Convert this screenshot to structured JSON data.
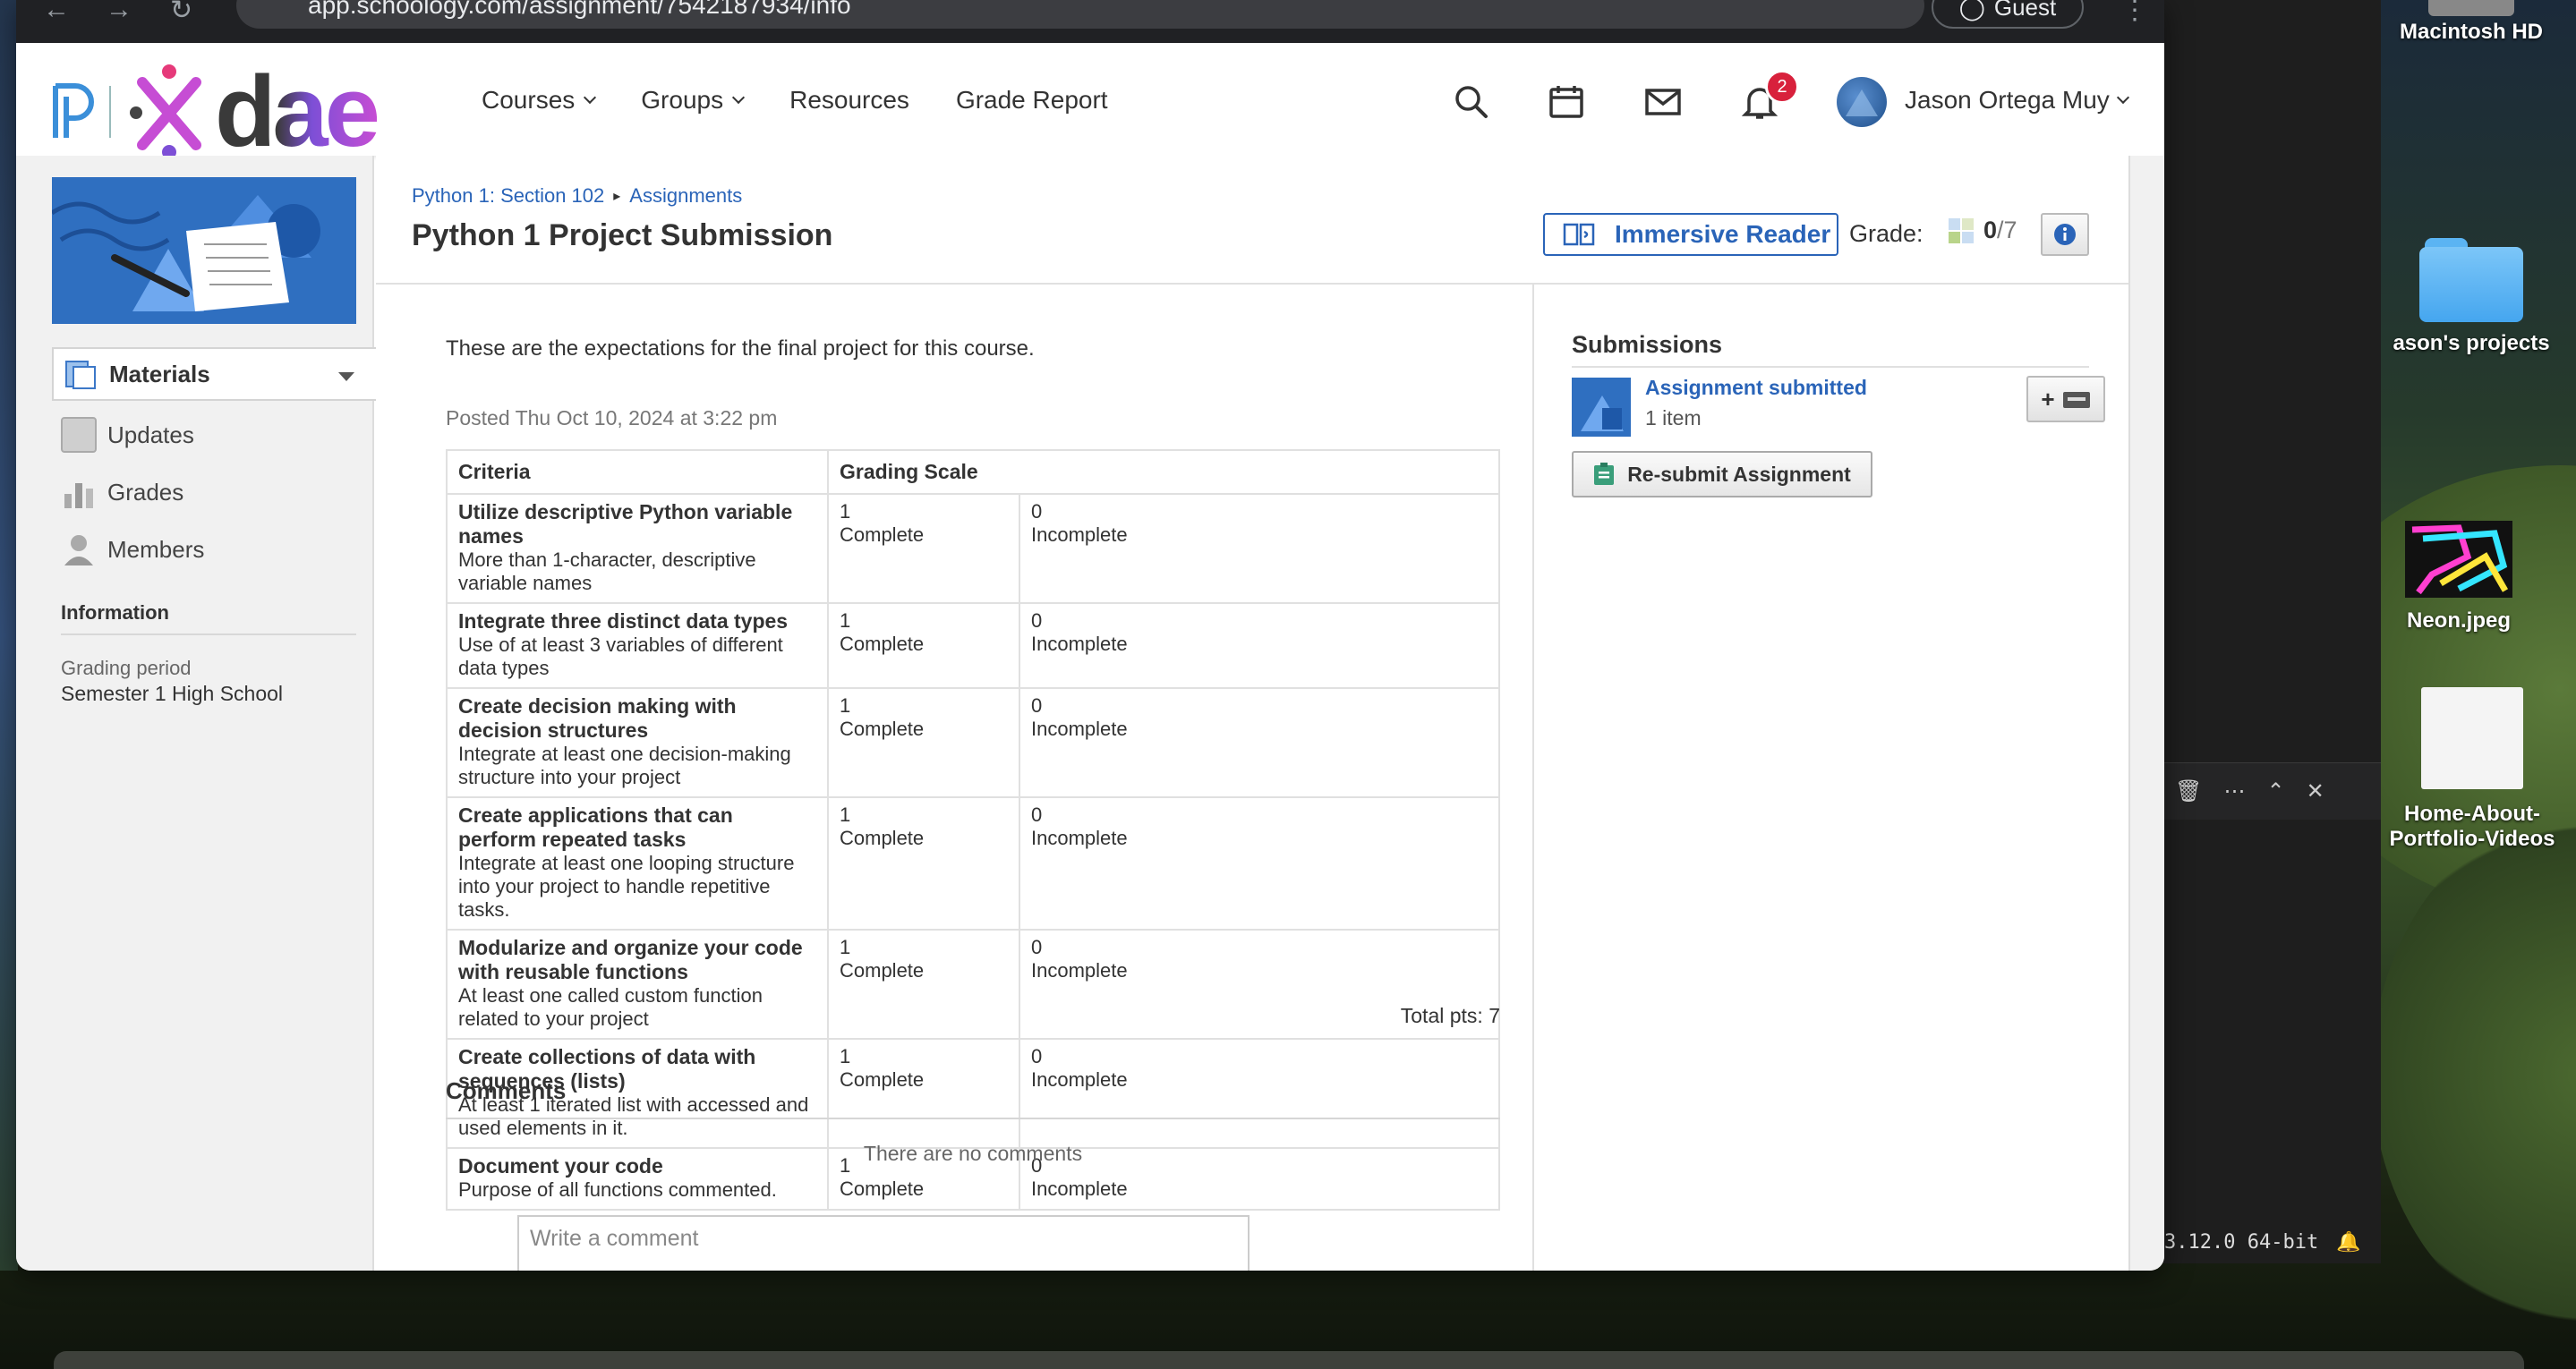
{
  "browser": {
    "url": "app.schoology.com/assignment/7542187934/info",
    "guest_label": "Guest"
  },
  "header": {
    "nav": [
      {
        "label": "Courses",
        "dropdown": true
      },
      {
        "label": "Groups",
        "dropdown": true
      },
      {
        "label": "Resources",
        "dropdown": false
      },
      {
        "label": "Grade Report",
        "dropdown": false
      }
    ],
    "notification_count": "2",
    "user_name": "Jason Ortega Muy"
  },
  "sidebar": {
    "selected": "Materials",
    "items": [
      {
        "label": "Updates",
        "icon": "updates-icon"
      },
      {
        "label": "Grades",
        "icon": "grades-icon"
      },
      {
        "label": "Members",
        "icon": "members-icon"
      }
    ],
    "info_heading": "Information",
    "grading_period_label": "Grading period",
    "grading_period_value": "Semester 1 High School"
  },
  "assignment": {
    "breadcrumb": [
      "Python 1: Section 102",
      "Assignments"
    ],
    "title": "Python 1 Project Submission",
    "immersive_reader_label": "Immersive Reader",
    "grade_label": "Grade:",
    "grade_score": "0",
    "grade_total": "/7",
    "description": "These are the expectations for the final project for this course.",
    "posted": "Posted Thu Oct 10, 2024 at 3:22 pm",
    "rubric": {
      "headers": [
        "Criteria",
        "Grading Scale"
      ],
      "rows": [
        {
          "title": "Utilize descriptive Python variable names",
          "desc": "More than 1-character, descriptive variable names",
          "hi_pts": "1",
          "hi_label": "Complete",
          "lo_pts": "0",
          "lo_label": "Incomplete"
        },
        {
          "title": "Integrate three distinct data types",
          "desc": "Use of at least 3 variables of different data types",
          "hi_pts": "1",
          "hi_label": "Complete",
          "lo_pts": "0",
          "lo_label": "Incomplete"
        },
        {
          "title": "Create decision making with decision structures",
          "desc": "Integrate at least one decision-making structure into your project",
          "hi_pts": "1",
          "hi_label": "Complete",
          "lo_pts": "0",
          "lo_label": "Incomplete"
        },
        {
          "title": "Create applications that can perform repeated tasks",
          "desc": "Integrate at least one looping structure into your project to handle repetitive tasks.",
          "hi_pts": "1",
          "hi_label": "Complete",
          "lo_pts": "0",
          "lo_label": "Incomplete"
        },
        {
          "title": "Modularize and organize your code with reusable functions",
          "desc": "At least one called custom function related to your project",
          "hi_pts": "1",
          "hi_label": "Complete",
          "lo_pts": "0",
          "lo_label": "Incomplete"
        },
        {
          "title": "Create collections of data with sequences (lists)",
          "desc": "At least 1 iterated list with accessed and used elements in it.",
          "hi_pts": "1",
          "hi_label": "Complete",
          "lo_pts": "0",
          "lo_label": "Incomplete"
        },
        {
          "title": "Document your code",
          "desc": "Purpose of all functions commented.",
          "hi_pts": "1",
          "hi_label": "Complete",
          "lo_pts": "0",
          "lo_label": "Incomplete"
        }
      ]
    },
    "total_pts": "Total pts: 7",
    "comments_heading": "Comments",
    "no_comments": "There are no comments",
    "comment_placeholder": "Write a comment"
  },
  "submissions": {
    "heading": "Submissions",
    "status": "Assignment submitted",
    "items": "1 item",
    "resubmit_label": "Re-submit Assignment"
  },
  "desktop": {
    "icons": [
      {
        "label": "Macintosh HD"
      },
      {
        "label": "ason's projects"
      },
      {
        "label": "Neon.jpeg"
      },
      {
        "label": "Home-About-Portfolio-Videos"
      }
    ],
    "terminal_status": "3.12.0 64-bit"
  },
  "colors": {
    "link": "#2a64b8",
    "badge": "#d8213c",
    "course_image": "#2f6fc0"
  }
}
